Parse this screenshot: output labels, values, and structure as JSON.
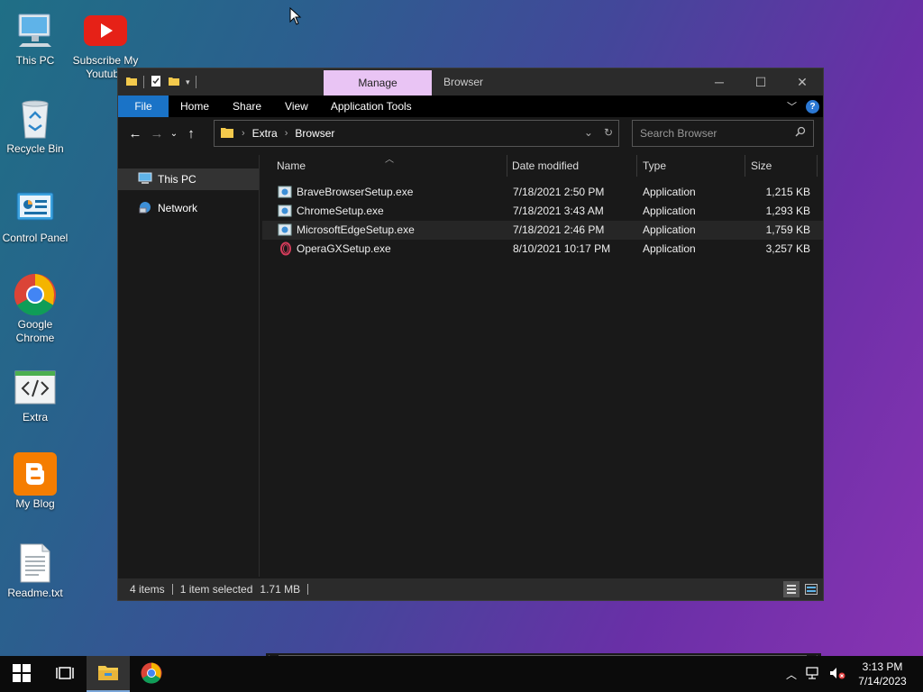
{
  "desktop": {
    "icons": [
      {
        "label": "This PC",
        "icon": "this-pc-icon"
      },
      {
        "label": "Subscribe My Youtube",
        "icon": "youtube-icon"
      },
      {
        "label": "Recycle Bin",
        "icon": "recycle-bin-icon"
      },
      {
        "label": "Control Panel",
        "icon": "control-panel-icon"
      },
      {
        "label": "Google Chrome",
        "icon": "chrome-icon"
      },
      {
        "label": "Extra",
        "icon": "code-folder-icon"
      },
      {
        "label": "My Blog",
        "icon": "blogger-icon"
      },
      {
        "label": "Readme.txt",
        "icon": "text-file-icon"
      }
    ]
  },
  "window": {
    "context_tab": "Manage",
    "title": "Browser",
    "ribbon_tabs": [
      "File",
      "Home",
      "Share",
      "View",
      "Application Tools"
    ],
    "breadcrumb": [
      "Extra",
      "Browser"
    ],
    "search_placeholder": "Search Browser",
    "nav_items": [
      "This PC",
      "Network"
    ],
    "columns": [
      "Name",
      "Date modified",
      "Type",
      "Size"
    ],
    "files": [
      {
        "name": "BraveBrowserSetup.exe",
        "date": "7/18/2021 2:50 PM",
        "type": "Application",
        "size": "1,215 KB"
      },
      {
        "name": "ChromeSetup.exe",
        "date": "7/18/2021 3:43 AM",
        "type": "Application",
        "size": "1,293 KB"
      },
      {
        "name": "MicrosoftEdgeSetup.exe",
        "date": "7/18/2021 2:46 PM",
        "type": "Application",
        "size": "1,759 KB"
      },
      {
        "name": "OperaGXSetup.exe",
        "date": "8/10/2021 10:17 PM",
        "type": "Application",
        "size": "3,257 KB"
      }
    ],
    "status": {
      "items": "4 items",
      "selected": "1 item selected",
      "size": "1.71 MB"
    }
  },
  "taskbar": {
    "time": "3:13 PM",
    "date": "7/14/2023"
  },
  "colors": {
    "accent": "#1a73c7",
    "manage_tab": "#e9c4f4",
    "youtube_red": "#e62117",
    "blogger_orange": "#f57d00"
  }
}
